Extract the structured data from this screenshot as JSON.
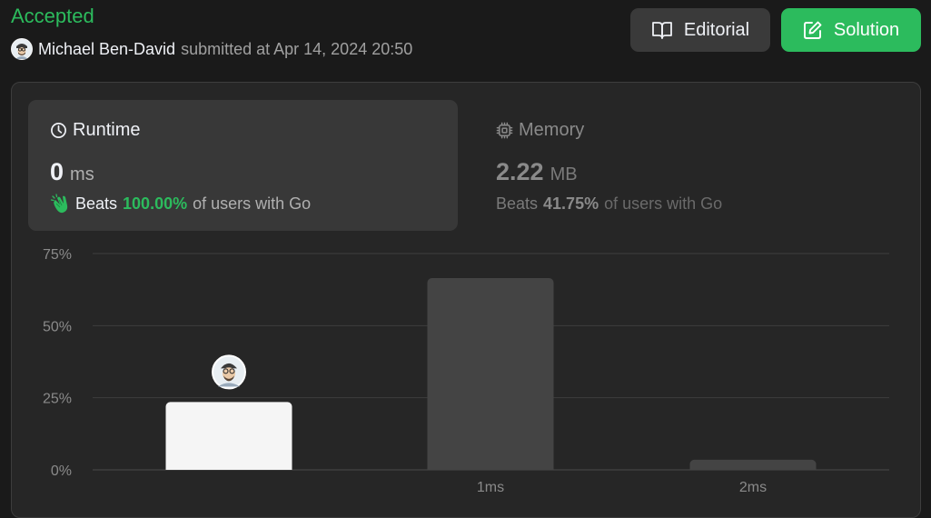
{
  "header": {
    "status": "Accepted",
    "submitter_name": "Michael Ben-David",
    "submitted_text": "submitted at Apr 14, 2024 20:50",
    "editorial_label": "Editorial",
    "solution_label": "Solution"
  },
  "runtime": {
    "title": "Runtime",
    "value": "0",
    "unit": "ms",
    "beats_label": "Beats",
    "beats_pct": "100.00%",
    "beats_suffix": "of users with Go"
  },
  "memory": {
    "title": "Memory",
    "value": "2.22",
    "unit": "MB",
    "beats_label": "Beats",
    "beats_pct": "41.75%",
    "beats_suffix": "of users with Go"
  },
  "icons": {
    "status_avatar": "avatar-icon",
    "editorial": "book-open-icon",
    "solution": "edit-icon",
    "runtime": "clock-icon",
    "memory": "chip-icon",
    "beats": "clap-icon"
  },
  "colors": {
    "accent_green": "#2cbb5d",
    "selected_bar": "#f5f5f5",
    "other_bar": "#444444"
  },
  "chart_data": {
    "type": "bar",
    "categories": [
      "",
      "1ms",
      "2ms"
    ],
    "values": [
      23.5,
      66.5,
      3.5
    ],
    "yticks": [
      "0%",
      "25%",
      "50%",
      "75%"
    ],
    "ytick_values": [
      0,
      25,
      50,
      75
    ],
    "ylim": [
      0,
      75
    ],
    "grid": true,
    "highlight_index": 0
  }
}
